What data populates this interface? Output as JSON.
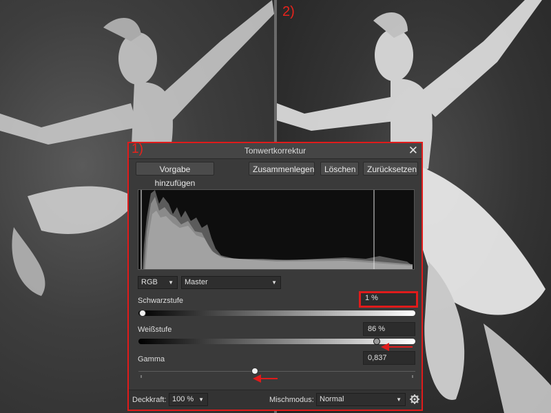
{
  "panes": {
    "left_label": "",
    "right_label": "2)"
  },
  "dialog": {
    "number_label": "1)",
    "title": "Tonwertkorrektur",
    "close_glyph": "✕",
    "buttons": {
      "add_preset": "Vorgabe hinzufügen",
      "merge": "Zusammenlegen",
      "delete": "Löschen",
      "reset": "Zurücksetzen"
    },
    "color_model": "RGB",
    "channel": "Master",
    "black_level": {
      "label": "Schwarzstufe",
      "value": "1 %",
      "level": 0.01
    },
    "white_level": {
      "label": "Weißstufe",
      "value": "86 %",
      "level": 0.86
    },
    "gamma": {
      "label": "Gamma",
      "value": "0,837"
    },
    "footer": {
      "opacity_label": "Deckkraft:",
      "opacity_value": "100 %",
      "blend_label": "Mischmodus:",
      "blend_value": "Normal"
    }
  },
  "colors": {
    "annotation_red": "#e01b1b",
    "dialog_bg": "#3a3a3a"
  },
  "icons": {
    "close": "close-icon",
    "settings": "gear-icon",
    "dropdown": "chevron-down-icon"
  }
}
